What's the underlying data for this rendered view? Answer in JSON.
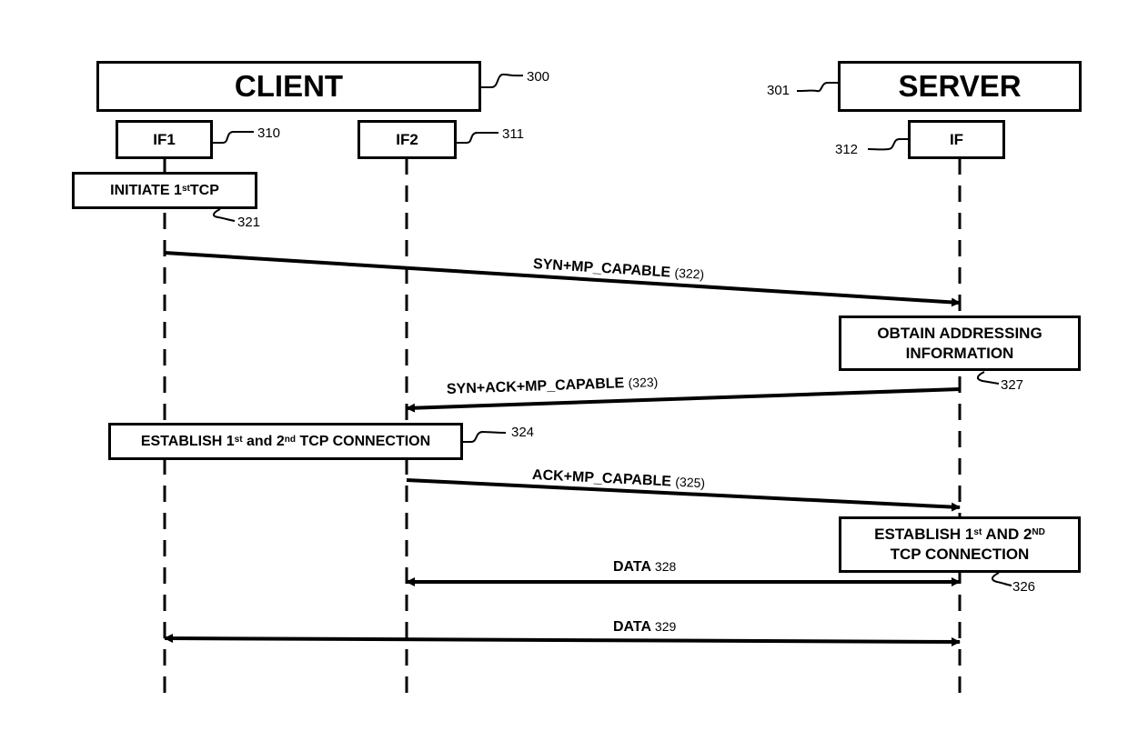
{
  "entities": {
    "client": {
      "label": "CLIENT",
      "ref": "300"
    },
    "server": {
      "label": "SERVER",
      "ref": "301"
    }
  },
  "interfaces": [
    {
      "label": "IF1",
      "ref": "310"
    },
    {
      "label": "IF2",
      "ref": "311"
    },
    {
      "label": "IF",
      "ref": "312"
    }
  ],
  "actions": {
    "initiate": {
      "pre": "INITIATE 1",
      "sup": "st",
      "post": " TCP",
      "ref": "321"
    },
    "obtain": {
      "line1": "OBTAIN ADDRESSING",
      "line2": "INFORMATION",
      "ref": "327"
    },
    "establish_client": {
      "a": "ESTABLISH 1",
      "sup1": "st",
      "b": " and 2",
      "sup2": "nd",
      "c": " TCP CONNECTION",
      "ref": "324"
    },
    "establish_server": {
      "a": "ESTABLISH 1",
      "sup1": "st",
      "b": " AND 2",
      "sup2": "ND",
      "line2": "TCP CONNECTION",
      "ref": "326"
    }
  },
  "messages": [
    {
      "label": "SYN+MP_CAPABLE",
      "ref": "(322)",
      "from": "IF1",
      "to": "IF"
    },
    {
      "label": "SYN+ACK+MP_CAPABLE",
      "ref": "(323)",
      "from": "IF",
      "to": "IF2"
    },
    {
      "label": "ACK+MP_CAPABLE",
      "ref": "(325)",
      "from": "IF2",
      "to": "IF"
    },
    {
      "label": "DATA",
      "ref": "328",
      "from": "IF2",
      "to": "IF",
      "bidirectional": true
    },
    {
      "label": "DATA",
      "ref": "329",
      "from": "IF1",
      "to": "IF",
      "bidirectional": true
    }
  ]
}
